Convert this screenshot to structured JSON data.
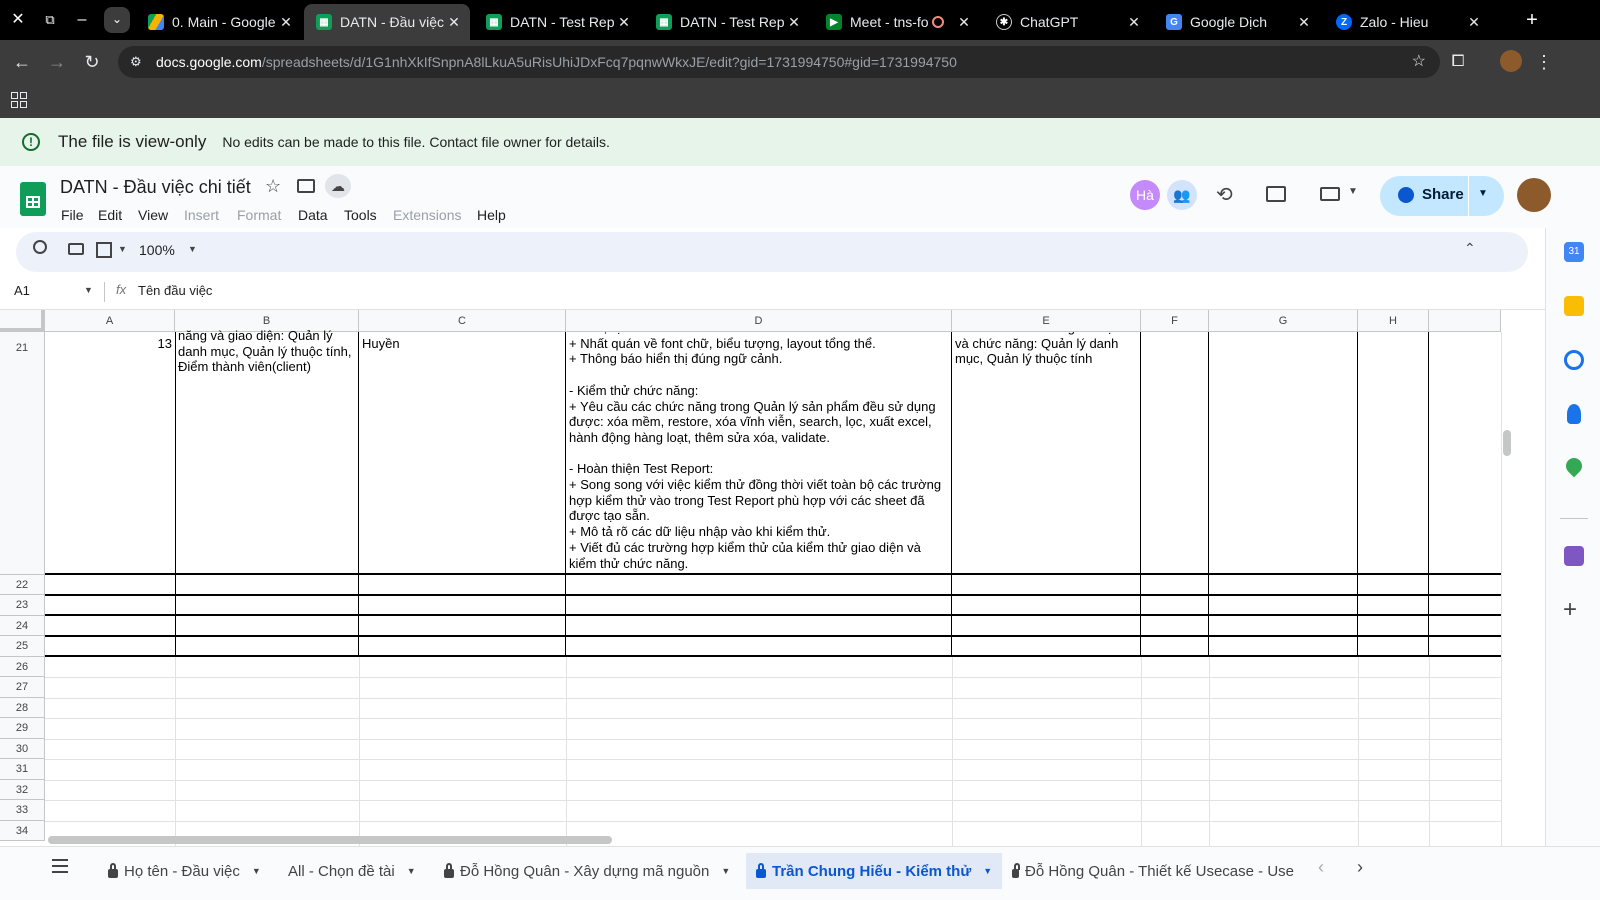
{
  "browser": {
    "tabs": [
      {
        "label": "0. Main - Google",
        "color": "#1a73e8"
      },
      {
        "label": "DATN - Đầu việc",
        "color": "#0f9d58"
      },
      {
        "label": "DATN - Test Repo",
        "color": "#0f9d58"
      },
      {
        "label": "DATN - Test Repo",
        "color": "#0f9d58"
      },
      {
        "label": "Meet - tns-fo",
        "color": "#00832d"
      },
      {
        "label": "ChatGPT",
        "color": "#444444"
      },
      {
        "label": "Google Dịch",
        "color": "#4285f4"
      },
      {
        "label": "Zalo - Hieu",
        "color": "#0068ff"
      }
    ],
    "url_host": "docs.google.com",
    "url_path": "/spreadsheets/d/1G1nhXkIfSnpnA8lLkuA5uRisUhiJDxFcq7pqnwWkxJE/edit?gid=1731994750#gid=1731994750"
  },
  "banner": {
    "title": "The file is view-only",
    "message": "No edits can be made to this file. Contact file owner for details."
  },
  "doc": {
    "title": "DATN - Đầu việc chi tiết",
    "menus": [
      "File",
      "Edit",
      "View",
      "Insert",
      "Format",
      "Data",
      "Tools",
      "Extensions",
      "Help"
    ],
    "share_label": "Share",
    "avatar_initials": "Hà"
  },
  "toolbar": {
    "zoom": "100%"
  },
  "formula": {
    "cell_ref": "A1",
    "fx": "fx",
    "content": "Tên đầu việc"
  },
  "grid": {
    "columns": [
      "A",
      "B",
      "C",
      "D",
      "E",
      "F",
      "G",
      "H"
    ],
    "rows": [
      "21",
      "22",
      "23",
      "24",
      "25",
      "26",
      "27",
      "28",
      "29",
      "30",
      "31",
      "32",
      "33",
      "34"
    ],
    "row21": {
      "a": "13",
      "b": "năng và giao diện: Quản lý danh mục, Quản lý thuộc tính, Điểm thành viên(client)",
      "c": "Huyền",
      "d": "thước, vị trí.\n+ Nhất quán về font chữ, biểu tượng, layout tổng thể.\n+ Thông báo hiển thị đúng ngữ cảnh.\n\n- Kiểm thử chức năng:\n+ Yêu cầu các chức năng trong Quản lý sản phẩm đều sử dụng được: xóa mềm, restore, xóa vĩnh viễn, search, lọc, xuất excel, hành động hàng loạt, thêm sửa xóa, validate.\n\n- Hoàn thiện Test Report:\n+ Song song với việc kiểm thử đồng thời viết toàn bộ các trường hợp kiểm thử vào trong Test Report phù hợp với các sheet đã được tạo sẵn.\n+ Mô tả rõ các dữ liệu nhập vào khi kiểm thử.\n+ Viết đủ các trường hợp kiểm thử của kiểm thử giao diện và kiểm thử chức năng.",
      "e": "Đã hoàn thành các giao diện và chức năng: Quản lý danh mục, Quản lý thuộc tính"
    }
  },
  "sheets": [
    "Họ tên - Đầu việc",
    "All - Chọn đề tài",
    "Đỗ Hồng Quân - Xây dựng mã nguồn",
    "Trần Chung Hiếu - Kiểm thử",
    "Đỗ Hồng Quân - Thiết kế Usecase - Use"
  ]
}
